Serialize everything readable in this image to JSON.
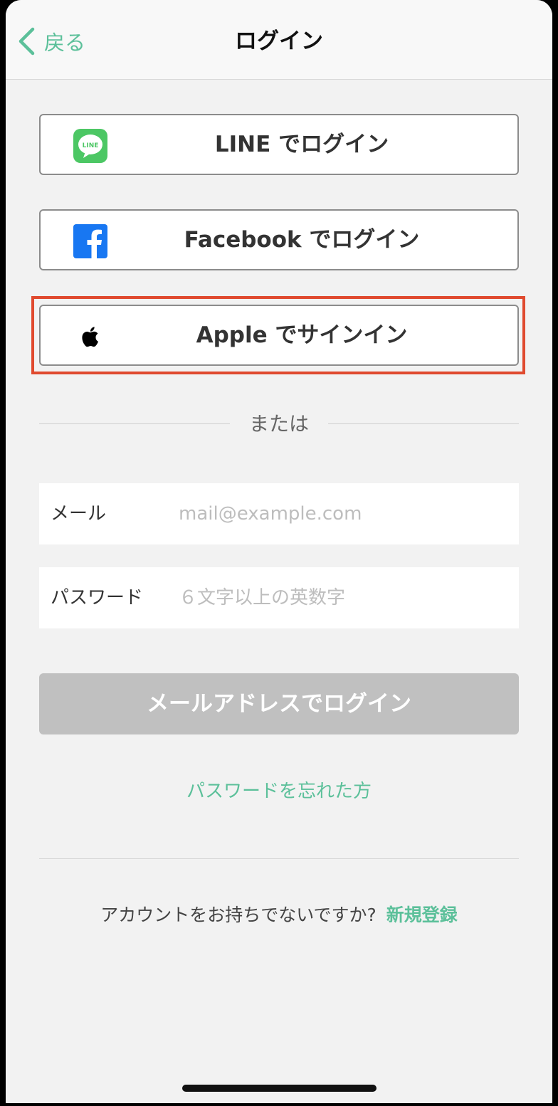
{
  "navbar": {
    "back_label": "戻る",
    "title": "ログイン"
  },
  "sso": {
    "line_label": "LINE でログイン",
    "line_icon_text": "LINE",
    "facebook_label": "Facebook でログイン",
    "apple_label": "Apple でサインイン"
  },
  "divider": {
    "text": "または"
  },
  "form": {
    "email_label": "メール",
    "email_placeholder": "mail@example.com",
    "email_value": "",
    "password_label": "パスワード",
    "password_placeholder": "６文字以上の英数字",
    "password_value": "",
    "submit_label": "メールアドレスでログイン"
  },
  "forgot": {
    "label": "パスワードを忘れた方"
  },
  "signup": {
    "prompt": "アカウントをお持ちでないですか?",
    "link_label": "新規登録"
  },
  "colors": {
    "accent": "#5cc09a",
    "line_green": "#4cc764",
    "facebook_blue": "#1877f2",
    "highlight_red": "#e04a2f",
    "disabled_button": "#c0c0c0"
  }
}
